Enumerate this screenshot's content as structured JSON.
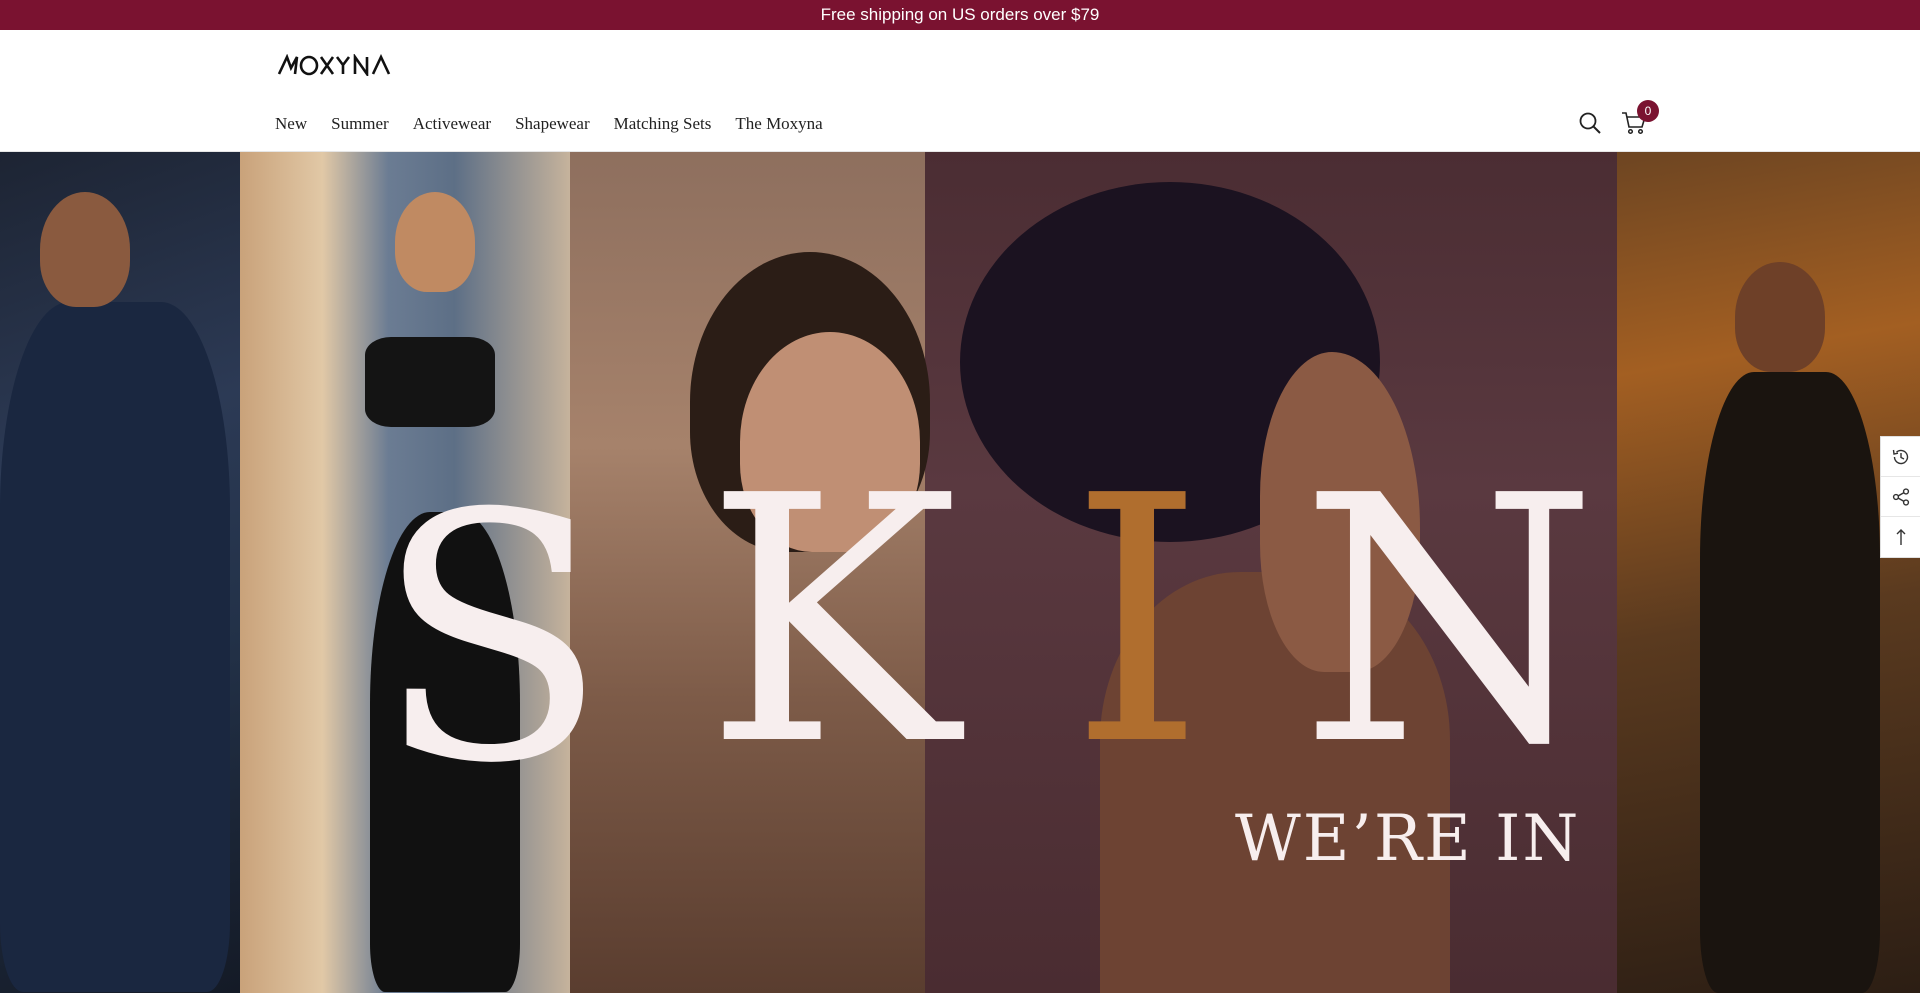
{
  "announcement": {
    "text": "Free shipping on US orders over $79"
  },
  "header": {
    "logo_text": "MOXYNA",
    "nav": [
      "New",
      "Summer",
      "Activewear",
      "Shapewear",
      "Matching Sets",
      "The Moxyna"
    ],
    "cart_count": "0",
    "icons": [
      "search-icon",
      "cart-icon"
    ]
  },
  "hero": {
    "letters": [
      "S",
      "K",
      "I",
      "N"
    ],
    "tagline": "WE’RE IN",
    "accent_color": "#b06e2e",
    "text_color": "#f7eeee"
  },
  "side_tools": [
    "history-icon",
    "share-icon",
    "back-to-top-icon"
  ],
  "colors": {
    "brand": "#7a1230"
  }
}
